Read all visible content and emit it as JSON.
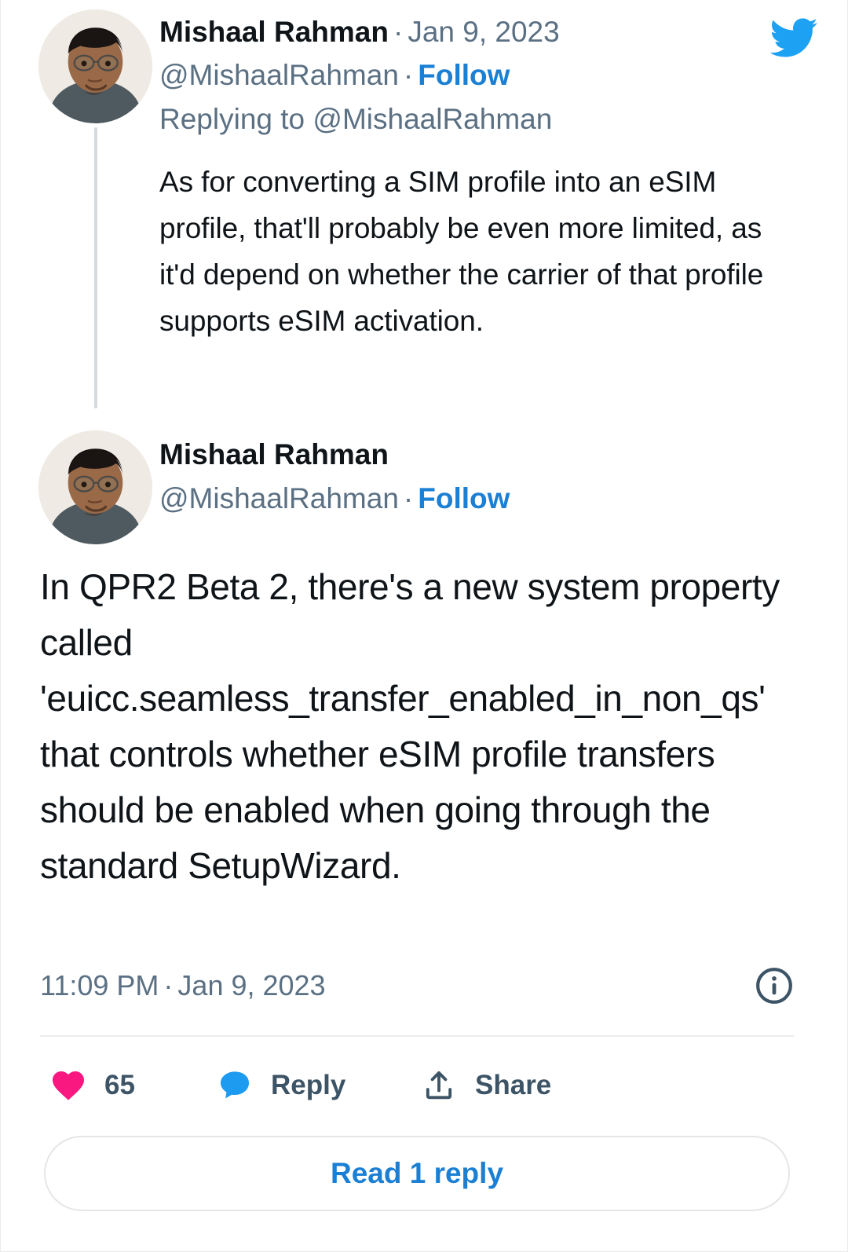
{
  "card": {
    "platform": "Twitter",
    "brand_color": "#1DA1F2"
  },
  "parent_tweet": {
    "display_name": "Mishaal Rahman",
    "separator": "·",
    "date": "Jan 9, 2023",
    "handle": "@MishaalRahman",
    "follow_label": "Follow",
    "replying_to_prefix": "Replying to ",
    "replying_to_handle": "@MishaalRahman",
    "body": "As for converting a SIM profile into an eSIM profile, that'll probably be even more limited, as it'd depend on whether the carrier of that profile supports eSIM activation.",
    "avatar_alt": "avatar"
  },
  "main_tweet": {
    "display_name": "Mishaal Rahman",
    "handle": "@MishaalRahman",
    "separator": "·",
    "follow_label": "Follow",
    "body": "In QPR2 Beta 2, there's a new system property called 'euicc.seamless_transfer_enabled_in_non_qs' that controls whether eSIM profile transfers should be enabled when going through the standard SetupWizard.",
    "time": "11:09 PM",
    "time_separator": "·",
    "date": "Jan 9, 2023",
    "avatar_alt": "avatar"
  },
  "actions": {
    "like_count": "65",
    "reply_label": "Reply",
    "share_label": "Share",
    "like_color": "#F91880",
    "reply_color": "#1D9BF0",
    "share_color": "#3D5466"
  },
  "footer": {
    "read_replies_label": "Read 1 reply"
  }
}
